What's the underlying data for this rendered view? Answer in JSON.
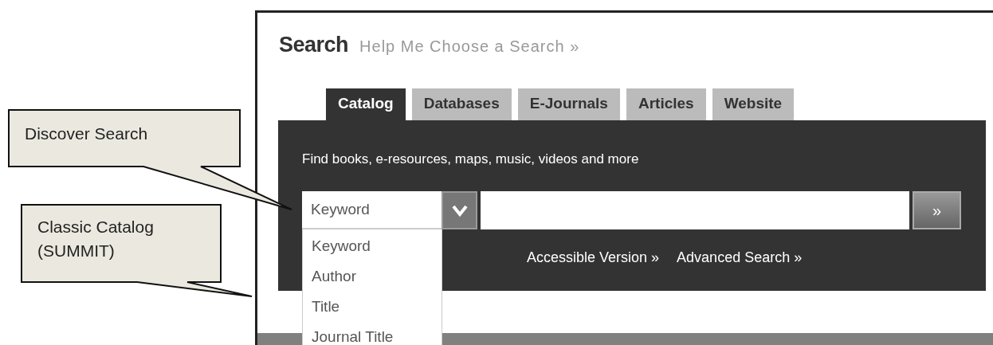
{
  "callouts": [
    {
      "text": "Discover Search"
    },
    {
      "text": "Classic Catalog (SUMMIT)"
    }
  ],
  "heading": {
    "title": "Search",
    "link": "Help Me Choose a Search »"
  },
  "tabs": [
    {
      "label": "Catalog",
      "selected": true
    },
    {
      "label": "Databases",
      "selected": false
    },
    {
      "label": "E-Journals",
      "selected": false
    },
    {
      "label": "Articles",
      "selected": false
    },
    {
      "label": "Website",
      "selected": false
    }
  ],
  "panel": {
    "description": "Find books, e-resources, maps, music, videos and more",
    "search_type": {
      "value": "Keyword",
      "expanded": true,
      "options": [
        "Keyword",
        "Author",
        "Title",
        "Journal Title"
      ]
    },
    "go_button": "»",
    "links": [
      "Accessible Version »",
      "Advanced Search »"
    ]
  }
}
